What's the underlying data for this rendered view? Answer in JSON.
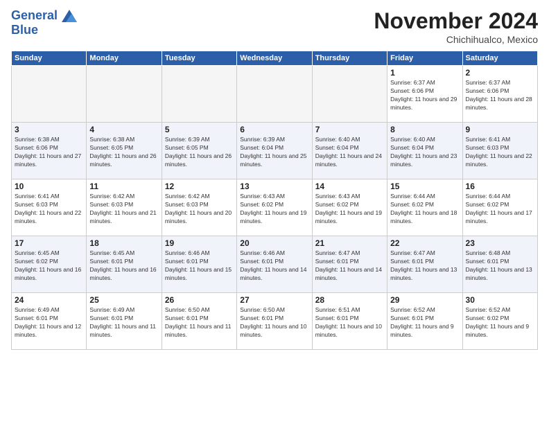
{
  "header": {
    "logo_line1": "General",
    "logo_line2": "Blue",
    "month_title": "November 2024",
    "location": "Chichihualco, Mexico"
  },
  "days_of_week": [
    "Sunday",
    "Monday",
    "Tuesday",
    "Wednesday",
    "Thursday",
    "Friday",
    "Saturday"
  ],
  "weeks": [
    [
      {
        "day": "",
        "info": ""
      },
      {
        "day": "",
        "info": ""
      },
      {
        "day": "",
        "info": ""
      },
      {
        "day": "",
        "info": ""
      },
      {
        "day": "",
        "info": ""
      },
      {
        "day": "1",
        "info": "Sunrise: 6:37 AM\nSunset: 6:06 PM\nDaylight: 11 hours and 29 minutes."
      },
      {
        "day": "2",
        "info": "Sunrise: 6:37 AM\nSunset: 6:06 PM\nDaylight: 11 hours and 28 minutes."
      }
    ],
    [
      {
        "day": "3",
        "info": "Sunrise: 6:38 AM\nSunset: 6:06 PM\nDaylight: 11 hours and 27 minutes."
      },
      {
        "day": "4",
        "info": "Sunrise: 6:38 AM\nSunset: 6:05 PM\nDaylight: 11 hours and 26 minutes."
      },
      {
        "day": "5",
        "info": "Sunrise: 6:39 AM\nSunset: 6:05 PM\nDaylight: 11 hours and 26 minutes."
      },
      {
        "day": "6",
        "info": "Sunrise: 6:39 AM\nSunset: 6:04 PM\nDaylight: 11 hours and 25 minutes."
      },
      {
        "day": "7",
        "info": "Sunrise: 6:40 AM\nSunset: 6:04 PM\nDaylight: 11 hours and 24 minutes."
      },
      {
        "day": "8",
        "info": "Sunrise: 6:40 AM\nSunset: 6:04 PM\nDaylight: 11 hours and 23 minutes."
      },
      {
        "day": "9",
        "info": "Sunrise: 6:41 AM\nSunset: 6:03 PM\nDaylight: 11 hours and 22 minutes."
      }
    ],
    [
      {
        "day": "10",
        "info": "Sunrise: 6:41 AM\nSunset: 6:03 PM\nDaylight: 11 hours and 22 minutes."
      },
      {
        "day": "11",
        "info": "Sunrise: 6:42 AM\nSunset: 6:03 PM\nDaylight: 11 hours and 21 minutes."
      },
      {
        "day": "12",
        "info": "Sunrise: 6:42 AM\nSunset: 6:03 PM\nDaylight: 11 hours and 20 minutes."
      },
      {
        "day": "13",
        "info": "Sunrise: 6:43 AM\nSunset: 6:02 PM\nDaylight: 11 hours and 19 minutes."
      },
      {
        "day": "14",
        "info": "Sunrise: 6:43 AM\nSunset: 6:02 PM\nDaylight: 11 hours and 19 minutes."
      },
      {
        "day": "15",
        "info": "Sunrise: 6:44 AM\nSunset: 6:02 PM\nDaylight: 11 hours and 18 minutes."
      },
      {
        "day": "16",
        "info": "Sunrise: 6:44 AM\nSunset: 6:02 PM\nDaylight: 11 hours and 17 minutes."
      }
    ],
    [
      {
        "day": "17",
        "info": "Sunrise: 6:45 AM\nSunset: 6:02 PM\nDaylight: 11 hours and 16 minutes."
      },
      {
        "day": "18",
        "info": "Sunrise: 6:45 AM\nSunset: 6:01 PM\nDaylight: 11 hours and 16 minutes."
      },
      {
        "day": "19",
        "info": "Sunrise: 6:46 AM\nSunset: 6:01 PM\nDaylight: 11 hours and 15 minutes."
      },
      {
        "day": "20",
        "info": "Sunrise: 6:46 AM\nSunset: 6:01 PM\nDaylight: 11 hours and 14 minutes."
      },
      {
        "day": "21",
        "info": "Sunrise: 6:47 AM\nSunset: 6:01 PM\nDaylight: 11 hours and 14 minutes."
      },
      {
        "day": "22",
        "info": "Sunrise: 6:47 AM\nSunset: 6:01 PM\nDaylight: 11 hours and 13 minutes."
      },
      {
        "day": "23",
        "info": "Sunrise: 6:48 AM\nSunset: 6:01 PM\nDaylight: 11 hours and 13 minutes."
      }
    ],
    [
      {
        "day": "24",
        "info": "Sunrise: 6:49 AM\nSunset: 6:01 PM\nDaylight: 11 hours and 12 minutes."
      },
      {
        "day": "25",
        "info": "Sunrise: 6:49 AM\nSunset: 6:01 PM\nDaylight: 11 hours and 11 minutes."
      },
      {
        "day": "26",
        "info": "Sunrise: 6:50 AM\nSunset: 6:01 PM\nDaylight: 11 hours and 11 minutes."
      },
      {
        "day": "27",
        "info": "Sunrise: 6:50 AM\nSunset: 6:01 PM\nDaylight: 11 hours and 10 minutes."
      },
      {
        "day": "28",
        "info": "Sunrise: 6:51 AM\nSunset: 6:01 PM\nDaylight: 11 hours and 10 minutes."
      },
      {
        "day": "29",
        "info": "Sunrise: 6:52 AM\nSunset: 6:01 PM\nDaylight: 11 hours and 9 minutes."
      },
      {
        "day": "30",
        "info": "Sunrise: 6:52 AM\nSunset: 6:02 PM\nDaylight: 11 hours and 9 minutes."
      }
    ]
  ]
}
